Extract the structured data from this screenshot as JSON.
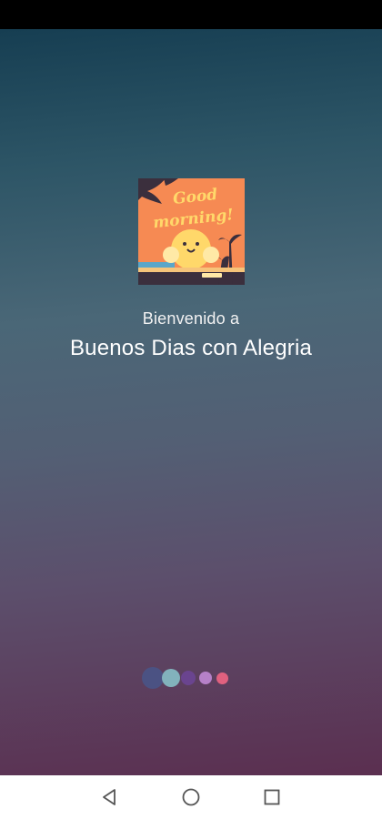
{
  "splash": {
    "welcome_text": "Bienvenido a",
    "app_name": "Buenos Dias con Alegria"
  },
  "logo": {
    "title_line1": "Good",
    "title_line2": "morning!",
    "icon": "sunrise-illustration-icon"
  },
  "loader": {
    "dots": [
      {
        "color": "#4b5283"
      },
      {
        "color": "#82b2bc"
      },
      {
        "color": "#6a448f"
      },
      {
        "color": "#b681c8"
      },
      {
        "color": "#e0617f"
      }
    ]
  },
  "nav": {
    "back_icon": "back-triangle-icon",
    "home_icon": "home-circle-icon",
    "recents_icon": "recents-square-icon"
  },
  "colors": {
    "gradient_top": "#163e52",
    "gradient_bottom": "#5b2f50",
    "logo_background": "#f68a53",
    "logo_text": "#ffd86a"
  }
}
